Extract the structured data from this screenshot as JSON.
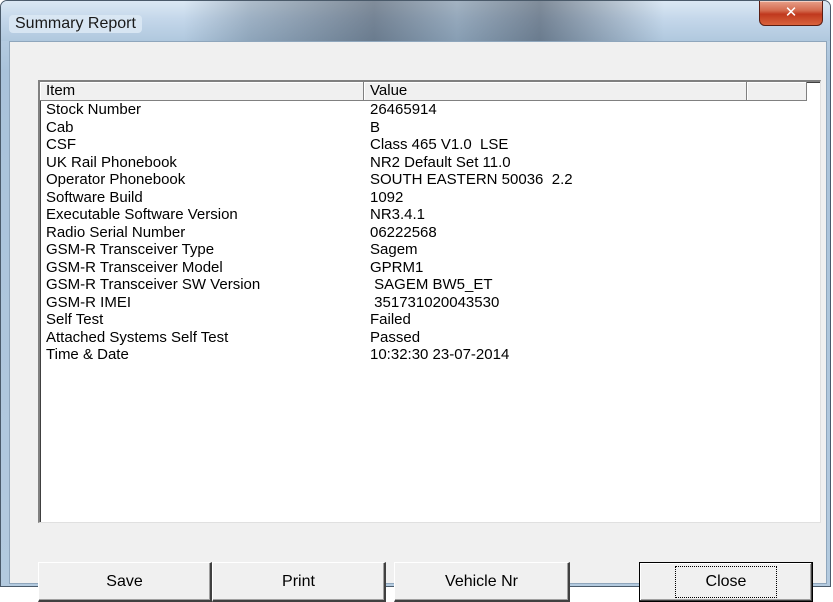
{
  "window": {
    "title": "Summary Report",
    "close_glyph": "✕"
  },
  "listview": {
    "columns": [
      "Item",
      "Value",
      ""
    ],
    "rows": [
      {
        "item": "Stock Number",
        "value": "26465914"
      },
      {
        "item": "Cab",
        "value": "B"
      },
      {
        "item": "CSF",
        "value": "Class 465 V1.0  LSE"
      },
      {
        "item": "UK Rail Phonebook",
        "value": "NR2 Default Set 11.0"
      },
      {
        "item": "Operator Phonebook",
        "value": "SOUTH EASTERN 50036  2.2"
      },
      {
        "item": "Software Build",
        "value": "1092"
      },
      {
        "item": "Executable Software Version",
        "value": "NR3.4.1"
      },
      {
        "item": "Radio Serial Number",
        "value": "06222568"
      },
      {
        "item": "GSM-R Transceiver Type",
        "value": "Sagem"
      },
      {
        "item": "GSM-R Transceiver Model",
        "value": "GPRM1"
      },
      {
        "item": "GSM-R Transceiver SW Version",
        "value": " SAGEM BW5_ET"
      },
      {
        "item": "GSM-R IMEI",
        "value": " 351731020043530"
      },
      {
        "item": "Self Test",
        "value": "Failed"
      },
      {
        "item": "Attached Systems Self Test",
        "value": "Passed"
      },
      {
        "item": "Time & Date",
        "value": "10:32:30 23-07-2014"
      }
    ]
  },
  "buttons": {
    "save": "Save",
    "print": "Print",
    "vehicle_nr": "Vehicle Nr",
    "close": "Close"
  }
}
